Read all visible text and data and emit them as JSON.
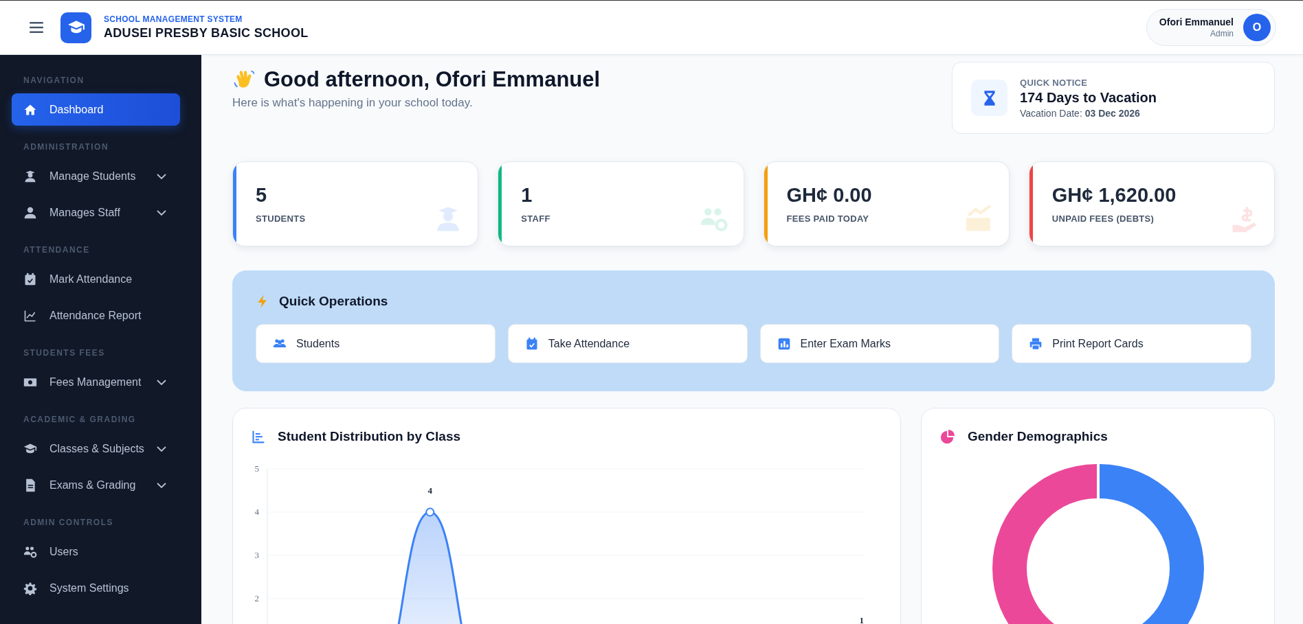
{
  "header": {
    "subtitle": "SCHOOL MANAGEMENT SYSTEM",
    "school_name": "ADUSEI PRESBY BASIC SCHOOL",
    "user": {
      "name": "Ofori Emmanuel",
      "role": "Admin",
      "initial": "O"
    }
  },
  "sidebar": {
    "sections": [
      {
        "title": "NAVIGATION",
        "items": [
          {
            "label": "Dashboard",
            "selected": true,
            "expandable": false
          }
        ]
      },
      {
        "title": "ADMINISTRATION",
        "items": [
          {
            "label": "Manage Students",
            "selected": false,
            "expandable": true
          },
          {
            "label": "Manages Staff",
            "selected": false,
            "expandable": true
          }
        ]
      },
      {
        "title": "ATTENDANCE",
        "items": [
          {
            "label": "Mark Attendance",
            "selected": false,
            "expandable": false
          },
          {
            "label": "Attendance Report",
            "selected": false,
            "expandable": false
          }
        ]
      },
      {
        "title": "STUDENTS FEES",
        "items": [
          {
            "label": "Fees Management",
            "selected": false,
            "expandable": true
          }
        ]
      },
      {
        "title": "ACADEMIC & GRADING",
        "items": [
          {
            "label": "Classes & Subjects",
            "selected": false,
            "expandable": true
          },
          {
            "label": "Exams & Grading",
            "selected": false,
            "expandable": true
          }
        ]
      },
      {
        "title": "ADMIN CONTROLS",
        "items": [
          {
            "label": "Users",
            "selected": false,
            "expandable": false
          },
          {
            "label": "System Settings",
            "selected": false,
            "expandable": false
          }
        ]
      }
    ]
  },
  "greeting": {
    "title": "Good afternoon, Ofori Emmanuel",
    "subtitle": "Here is what's happening in your school today."
  },
  "notice": {
    "label": "QUICK NOTICE",
    "title": "174 Days to Vacation",
    "detail": "Vacation Date: **03 Dec 2026**"
  },
  "stats": [
    {
      "value": "5",
      "label": "STUDENTS",
      "color": "#3b82f6"
    },
    {
      "value": "1",
      "label": "STAFF",
      "color": "#10b981"
    },
    {
      "value": "GH¢ 0.00",
      "label": "FEES PAID TODAY",
      "color": "#f59e0b"
    },
    {
      "value": "GH¢ 1,620.00",
      "label": "UNPAID FEES (DEBTS)",
      "color": "#ef4444"
    }
  ],
  "quick_operations": {
    "title": "Quick Operations",
    "buttons": [
      "Students",
      "Take Attendance",
      "Enter Exam Marks",
      "Print Report Cards"
    ]
  },
  "distribution_card": {
    "title": "Student Distribution by Class",
    "chart_data": {
      "type": "area",
      "ylim": [
        0,
        5
      ],
      "yticks": [
        2,
        3,
        4,
        5
      ],
      "grid": true,
      "series": [
        {
          "color": "#3b82f6",
          "values": [
            0,
            0,
            0,
            4,
            0,
            0,
            0,
            0,
            0,
            0,
            0,
            1
          ]
        }
      ],
      "value_labels": [
        null,
        null,
        null,
        "4",
        null,
        null,
        null,
        null,
        null,
        null,
        null,
        "1"
      ]
    }
  },
  "gender_card": {
    "title": "Gender Demographics"
  }
}
